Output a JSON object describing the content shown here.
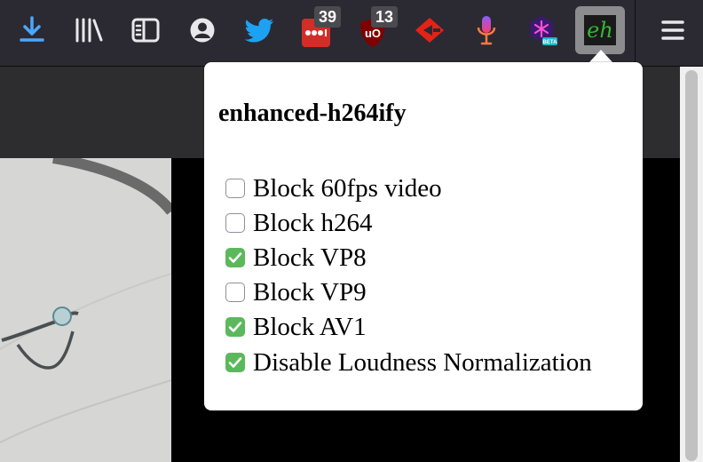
{
  "toolbar": {
    "badges": {
      "pocket_count": "39",
      "ublock_count": "13"
    },
    "extension_label": "eh",
    "icons": [
      "downloads-icon",
      "library-icon",
      "sidebar-icon",
      "account-icon",
      "twitter-icon",
      "lastpass-icon",
      "ublock-icon",
      "video-ext-icon",
      "microphone-icon",
      "beta-ext-icon",
      "enhanced-h264ify-icon",
      "menu-icon"
    ],
    "beta_label": "BETA"
  },
  "popup": {
    "title": "enhanced-h264ify",
    "options": [
      {
        "label": "Block 60fps video",
        "checked": false
      },
      {
        "label": "Block h264",
        "checked": false
      },
      {
        "label": "Block VP8",
        "checked": true
      },
      {
        "label": "Block VP9",
        "checked": false
      },
      {
        "label": "Block AV1",
        "checked": true
      },
      {
        "label": "Disable Loudness Normalization",
        "checked": true
      }
    ]
  },
  "colors": {
    "accent_green": "#5cb85c",
    "toolbar_bg": "#2b2a33",
    "download_blue": "#4aa8ff"
  }
}
